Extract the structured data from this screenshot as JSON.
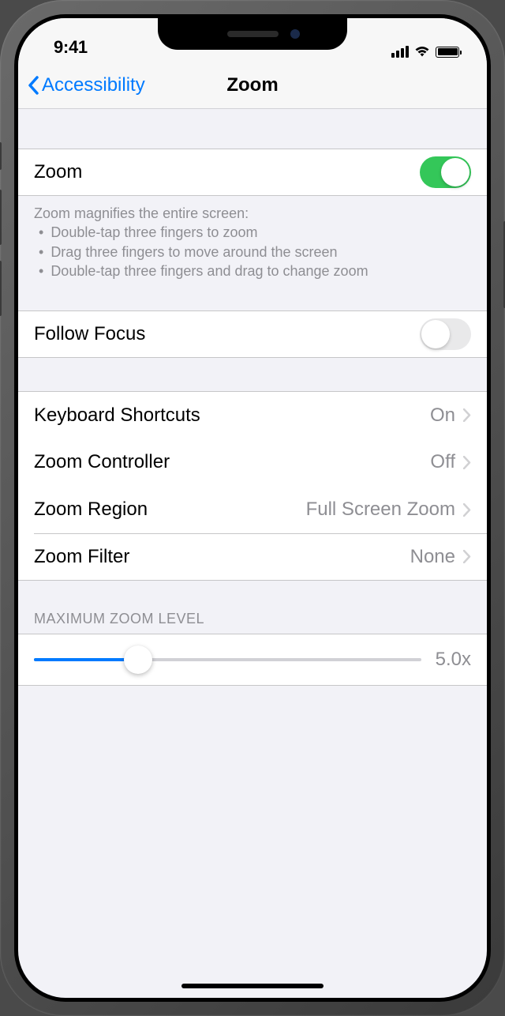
{
  "status": {
    "time": "9:41"
  },
  "nav": {
    "back_label": "Accessibility",
    "title": "Zoom"
  },
  "zoom_toggle": {
    "label": "Zoom",
    "enabled": true
  },
  "zoom_footer": {
    "intro": "Zoom magnifies the entire screen:",
    "bullets": [
      "Double-tap three fingers to zoom",
      "Drag three fingers to move around the screen",
      "Double-tap three fingers and drag to change zoom"
    ]
  },
  "follow_focus": {
    "label": "Follow Focus",
    "enabled": false
  },
  "options": [
    {
      "label": "Keyboard Shortcuts",
      "value": "On"
    },
    {
      "label": "Zoom Controller",
      "value": "Off"
    },
    {
      "label": "Zoom Region",
      "value": "Full Screen Zoom"
    },
    {
      "label": "Zoom Filter",
      "value": "None"
    }
  ],
  "slider": {
    "header": "Maximum Zoom Level",
    "value_label": "5.0x"
  }
}
